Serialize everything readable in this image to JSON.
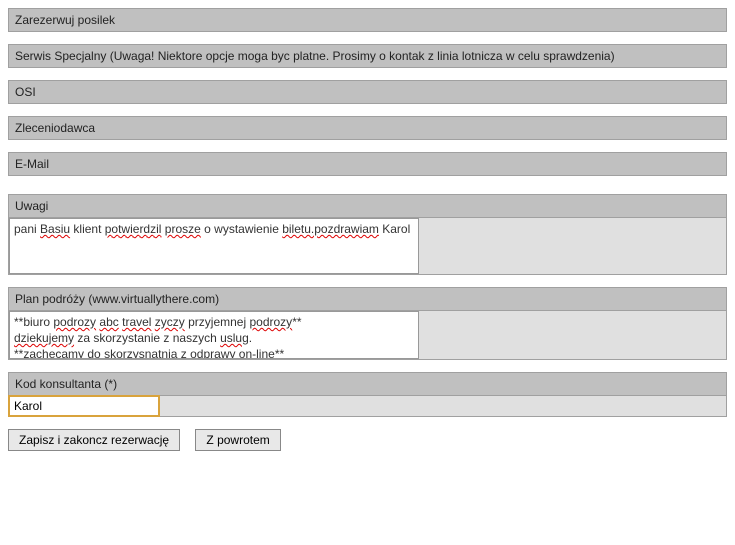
{
  "sections": {
    "meal": {
      "label": "Zarezerwuj posilek"
    },
    "special": {
      "label": "Serwis Specjalny (Uwaga! Niektore opcje moga byc platne. Prosimy o kontak z linia lotnicza w celu sprawdzenia)"
    },
    "osi": {
      "label": "OSI"
    },
    "principal": {
      "label": "Zleceniodawca"
    },
    "email": {
      "label": "E-Mail"
    },
    "notes": {
      "label": "Uwagi",
      "value": "pani Basiu klient potwierdzil prosze o wystawienie biletu.pozdrawiam Karol"
    },
    "itinerary": {
      "label": "Plan podróży (www.virtuallythere.com)",
      "value": "**biuro podrozy abc travel zyczy przyjemnej podrozy**\ndziekujemy za skorzystanie z naszych uslug.\n**zachecamy do skorzysnatnia z odprawy on-line**"
    },
    "consultant": {
      "label": "Kod konsultanta (*)",
      "value": "Karol"
    }
  },
  "buttons": {
    "save": "Zapisz i zakoncz rezerwację",
    "back": "Z powrotem"
  }
}
